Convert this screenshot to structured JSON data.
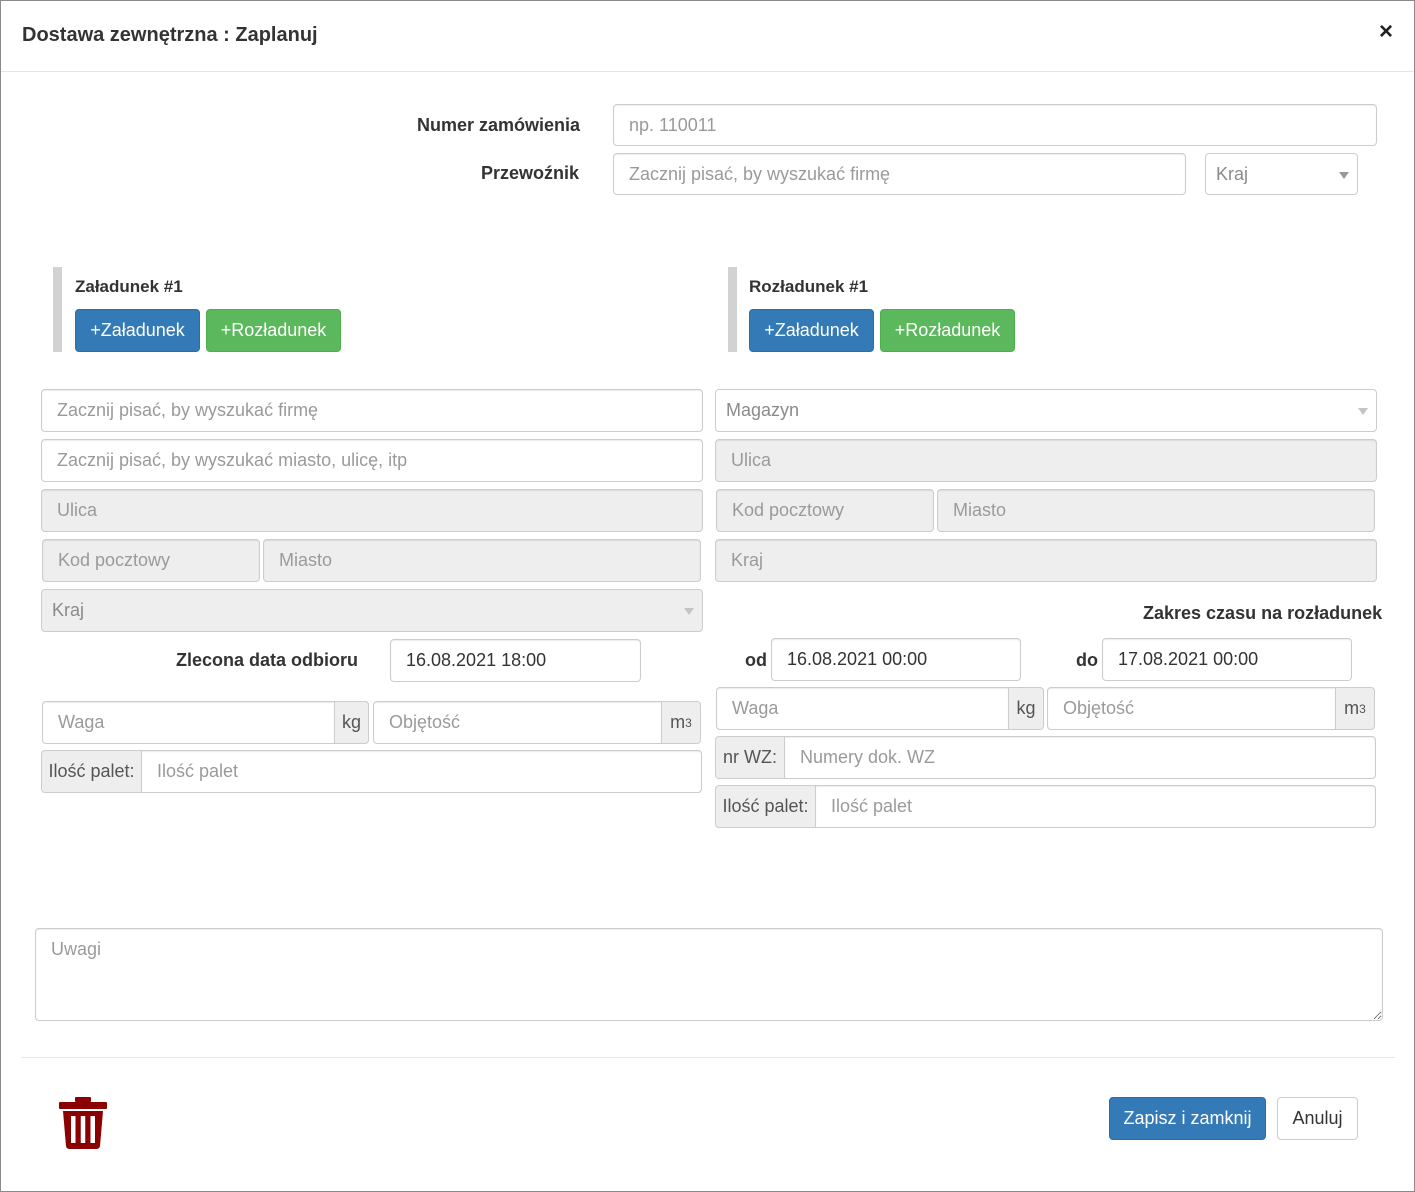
{
  "dialog": {
    "title": "Dostawa zewnętrzna : Zaplanuj",
    "close_symbol": "×"
  },
  "top": {
    "order_label": "Numer zamówienia",
    "order_placeholder": "np. 110011",
    "carrier_label": "Przewoźnik",
    "carrier_placeholder": "Zacznij pisać, by wyszukać firmę",
    "country_select": "Kraj"
  },
  "loading": {
    "heading": "Załadunek #1",
    "add_loading": "+Załadunek",
    "add_unloading": "+Rozładunek",
    "company_placeholder": "Zacznij pisać, by wyszukać firmę",
    "address_placeholder": "Zacznij pisać, by wyszukać miasto, ulicę, itp",
    "street_placeholder": "Ulica",
    "postcode_placeholder": "Kod pocztowy",
    "city_placeholder": "Miasto",
    "country_select": "Kraj",
    "pickup_date_label": "Zlecona data odbioru",
    "pickup_date_value": "16.08.2021 18:00",
    "weight_placeholder": "Waga",
    "weight_unit": "kg",
    "volume_placeholder": "Objętość",
    "volume_unit": "m",
    "volume_unit_exp": "3",
    "pallets_label": "Ilość palet:",
    "pallets_placeholder": "Ilość palet"
  },
  "unloading": {
    "heading": "Rozładunek #1",
    "add_loading": "+Załadunek",
    "add_unloading": "+Rozładunek",
    "warehouse_select": "Magazyn",
    "street_placeholder": "Ulica",
    "postcode_placeholder": "Kod pocztowy",
    "city_placeholder": "Miasto",
    "country_placeholder": "Kraj",
    "time_range_label": "Zakres czasu na rozładunek",
    "from_label": "od",
    "from_value": "16.08.2021 00:00",
    "to_label": "do",
    "to_value": "17.08.2021 00:00",
    "weight_placeholder": "Waga",
    "weight_unit": "kg",
    "volume_placeholder": "Objętość",
    "volume_unit": "m",
    "volume_unit_exp": "3",
    "wz_label": "nr WZ:",
    "wz_placeholder": "Numery dok. WZ",
    "pallets_label": "Ilość palet:",
    "pallets_placeholder": "Ilość palet"
  },
  "notes": {
    "placeholder": "Uwagi"
  },
  "footer": {
    "save_label": "Zapisz i zamknij",
    "cancel_label": "Anuluj",
    "delete_icon": "trash-icon",
    "delete_color": "#8b0000"
  },
  "colors": {
    "primary": "#337ab7",
    "success": "#5cb85c",
    "readonly_bg": "#eeeeee"
  }
}
